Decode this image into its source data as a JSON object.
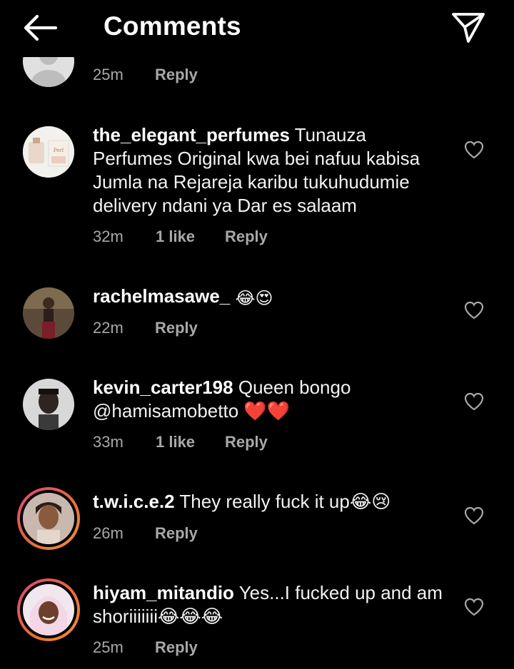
{
  "header": {
    "title": "Comments",
    "back_icon": "arrow-left-icon",
    "send_icon": "paper-plane-icon"
  },
  "comments": [
    {
      "username": "",
      "text": "",
      "time": "25m",
      "likes": "",
      "reply": "Reply"
    },
    {
      "username": "the_elegant_perfumes",
      "text": "Tunauza Perfumes Original kwa bei nafuu kabisa Jumla na Rejareja karibu tukuhudumie delivery ndani ya Dar es salaam",
      "time": "32m",
      "likes": "1 like",
      "reply": "Reply"
    },
    {
      "username": "rachelmasawe_",
      "text": "😂😍",
      "time": "22m",
      "likes": "",
      "reply": "Reply"
    },
    {
      "username": "kevin_carter198",
      "text": "Queen bongo @hamisamobetto ❤️❤️",
      "time": "33m",
      "likes": "1 like",
      "reply": "Reply"
    },
    {
      "username": "t.w.i.c.e.2",
      "text": "They really fuck it up😂😢",
      "time": "26m",
      "likes": "",
      "reply": "Reply"
    },
    {
      "username": "hiyam_mitandio",
      "text": "Yes...I fucked up and am shoriiiiiii😂😂😂",
      "time": "25m",
      "likes": "",
      "reply": "Reply"
    }
  ]
}
